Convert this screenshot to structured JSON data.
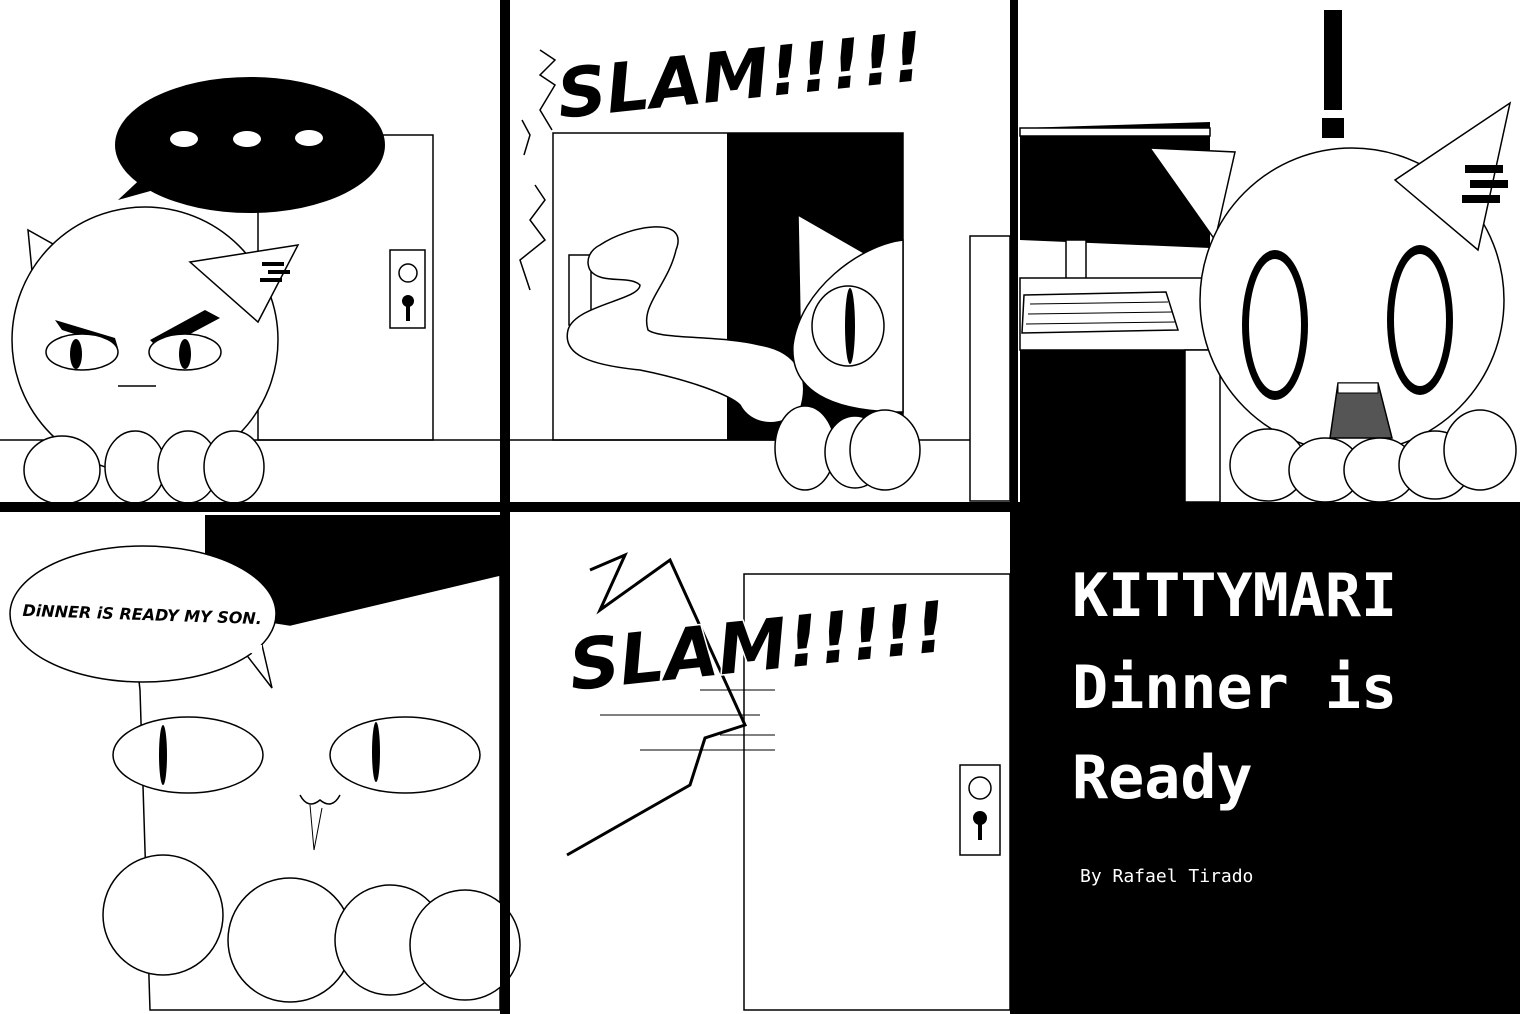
{
  "panel_1": {
    "speech_ellipsis": "...",
    "character_name": "kitty-son",
    "prop": "door"
  },
  "panel_2": {
    "sfx": "SLAM!!!!!"
  },
  "panel_3": {
    "exclamation": "!"
  },
  "panel_4": {
    "speech": "DiNNER iS READY MY SON."
  },
  "panel_5": {
    "sfx": "SLAM!!!!!"
  },
  "title_panel": {
    "title_line_1": "KITTYMARI",
    "title_line_2": "Dinner is",
    "title_line_3": "Ready",
    "byline": "By Rafael Tirado"
  },
  "colors": {
    "ink": "#000000",
    "paper": "#ffffff",
    "mouth": "#555555"
  }
}
